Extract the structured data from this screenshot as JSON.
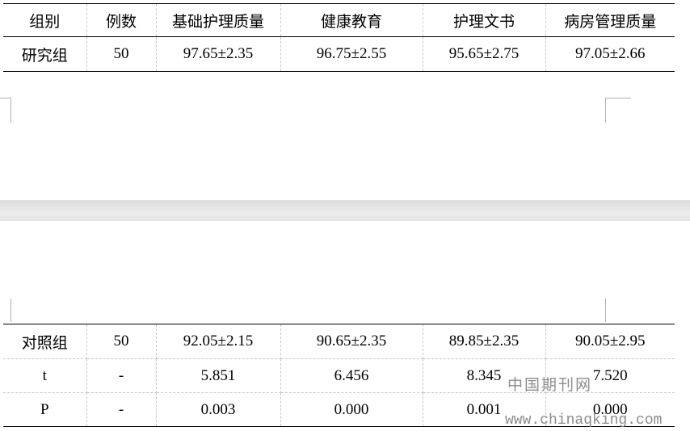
{
  "table": {
    "headers": [
      "组别",
      "例数",
      "基础护理质量",
      "健康教育",
      "护理文书",
      "病房管理质量"
    ],
    "top_rows": [
      [
        "研究组",
        "50",
        "97.65±2.35",
        "96.75±2.55",
        "95.65±2.75",
        "97.05±2.66"
      ]
    ],
    "bottom_rows": [
      [
        "对照组",
        "50",
        "92.05±2.15",
        "90.65±2.35",
        "89.85±2.35",
        "90.05±2.95"
      ],
      [
        "t",
        "-",
        "5.851",
        "6.456",
        "8.345",
        "7.520"
      ],
      [
        "P",
        "-",
        "0.003",
        "0.000",
        "0.001",
        "0.000"
      ]
    ]
  },
  "watermark": {
    "name": "中国期刊网",
    "url": "www.chinaqking.com"
  }
}
